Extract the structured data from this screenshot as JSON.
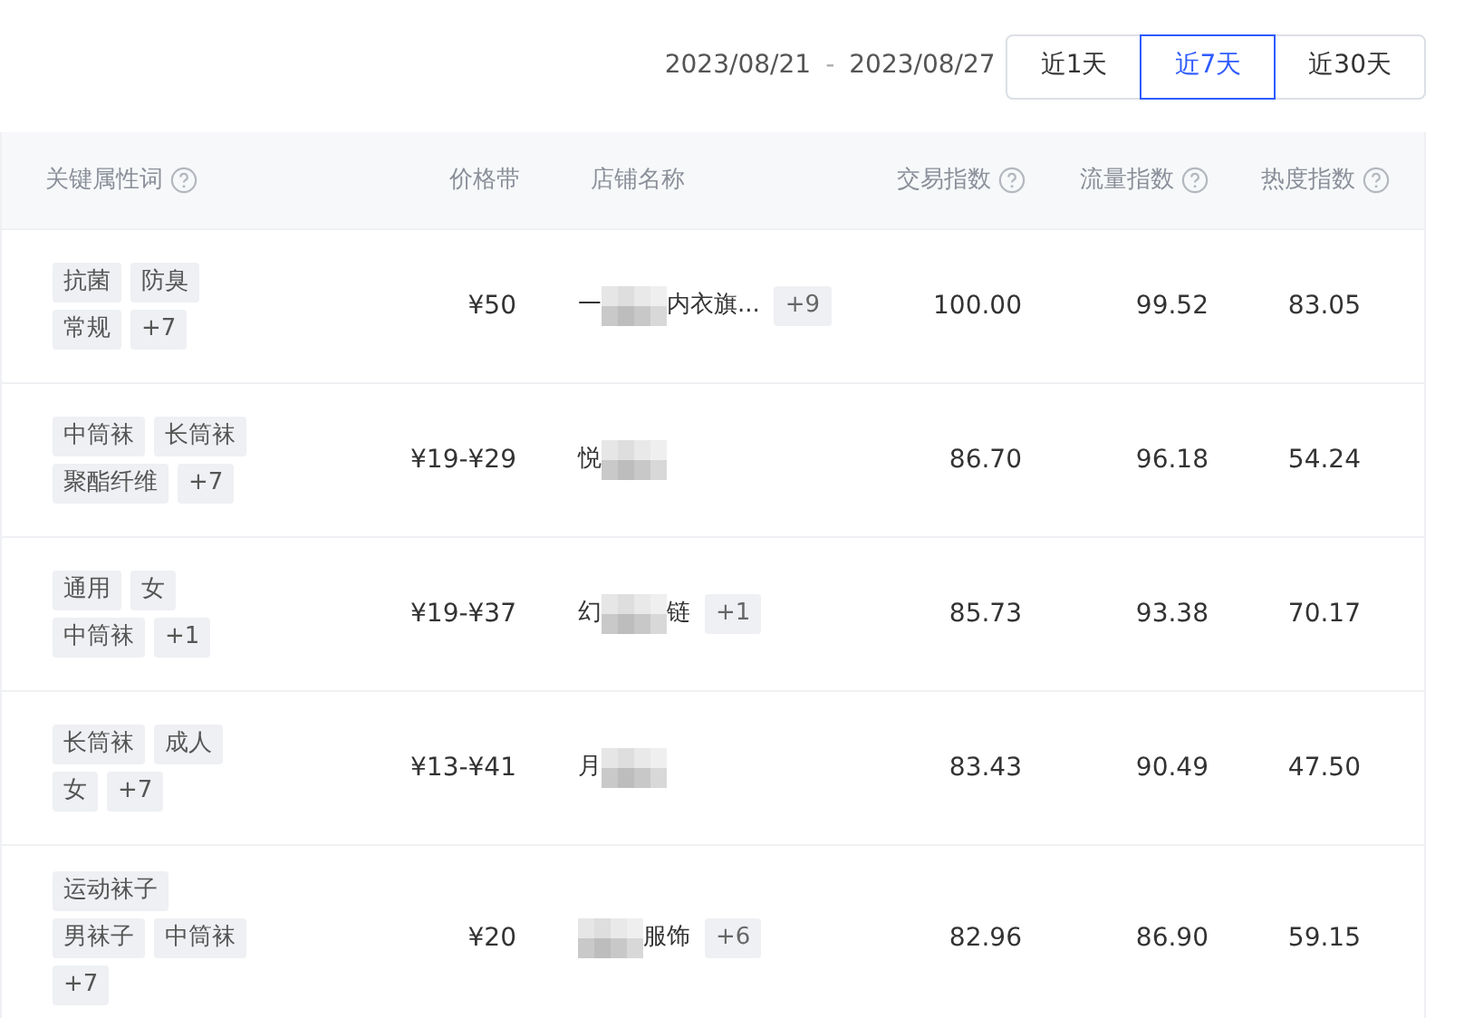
{
  "date_range": {
    "start": "2023/08/21",
    "separator": "-",
    "end": "2023/08/27"
  },
  "periods": [
    {
      "label": "近1天",
      "selected": false
    },
    {
      "label": "近7天",
      "selected": true
    },
    {
      "label": "近30天",
      "selected": false
    }
  ],
  "table": {
    "columns": [
      {
        "label": "关键属性词",
        "help": true
      },
      {
        "label": "价格带",
        "help": false
      },
      {
        "label": "店铺名称",
        "help": false
      },
      {
        "label": "交易指数",
        "help": true
      },
      {
        "label": "流量指数",
        "help": true
      },
      {
        "label": "热度指数",
        "help": true
      }
    ],
    "rows": [
      {
        "tags": [
          [
            "抗菌",
            "防臭"
          ],
          [
            "常规",
            "+7"
          ]
        ],
        "price": "¥50",
        "shop": {
          "prefix": "一",
          "suffix": "内衣旗...",
          "more": "+9"
        },
        "trade": "100.00",
        "flow": "99.52",
        "heat": "83.05"
      },
      {
        "tags": [
          [
            "中筒袜",
            "长筒袜"
          ],
          [
            "聚酯纤维",
            "+7"
          ]
        ],
        "price": "¥19-¥29",
        "shop": {
          "prefix": "悦"
        },
        "trade": "86.70",
        "flow": "96.18",
        "heat": "54.24"
      },
      {
        "tags": [
          [
            "通用",
            "女"
          ],
          [
            "中筒袜",
            "+1"
          ]
        ],
        "price": "¥19-¥37",
        "shop": {
          "prefix": "幻",
          "suffix": "链",
          "more": "+1"
        },
        "trade": "85.73",
        "flow": "93.38",
        "heat": "70.17"
      },
      {
        "tags": [
          [
            "长筒袜",
            "成人"
          ],
          [
            "女",
            "+7"
          ]
        ],
        "price": "¥13-¥41",
        "shop": {
          "prefix": "月"
        },
        "trade": "83.43",
        "flow": "90.49",
        "heat": "47.50"
      },
      {
        "tags": [
          [
            "运动袜子"
          ],
          [
            "男袜子",
            "中筒袜"
          ],
          [
            "+7"
          ]
        ],
        "price": "¥20",
        "shop": {
          "suffix": "服饰",
          "more": "+6"
        },
        "trade": "82.96",
        "flow": "86.90",
        "heat": "59.15"
      }
    ]
  }
}
